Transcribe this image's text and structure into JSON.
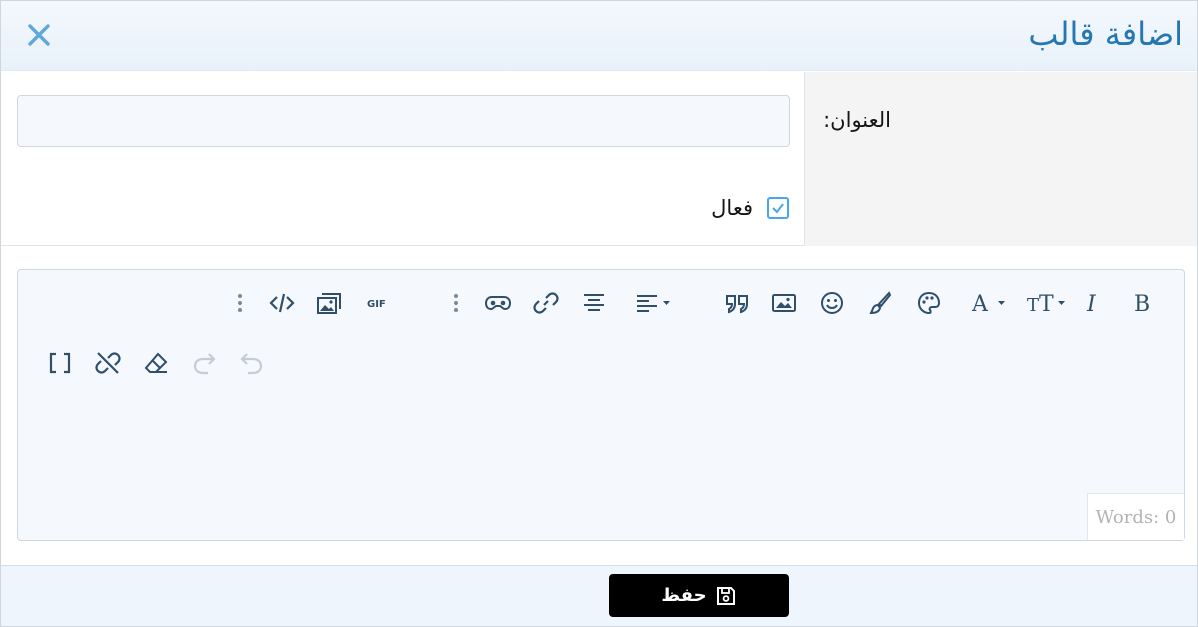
{
  "dialog": {
    "title": "اضافة قالب",
    "close_icon": "close-icon"
  },
  "form": {
    "title_label": "العنوان:",
    "title_value": "",
    "active_label": "فعال",
    "active_checked": true
  },
  "editor": {
    "toolbar_row1": [
      "bold-icon",
      "italic-icon",
      "font-size-icon",
      "font-color-icon",
      "palette-icon",
      "paint-brush-icon",
      "emoji-icon",
      "image-icon",
      "quote-icon",
      "align-dropdown-icon",
      "align-center-icon",
      "link-icon",
      "media-icon",
      "more-icon",
      "gif-icon",
      "gallery-icon",
      "code-icon",
      "more-icon"
    ],
    "toolbar_row2": [
      "undo-icon",
      "redo-icon",
      "eraser-icon",
      "unlink-icon",
      "brackets-icon"
    ],
    "word_count": "Words: 0"
  },
  "footer": {
    "save_label": "حفظ",
    "save_icon": "save-icon"
  },
  "colors": {
    "accent": "#2577b1",
    "checkbox": "#47a7eb",
    "icon": "#2f4f6b"
  }
}
